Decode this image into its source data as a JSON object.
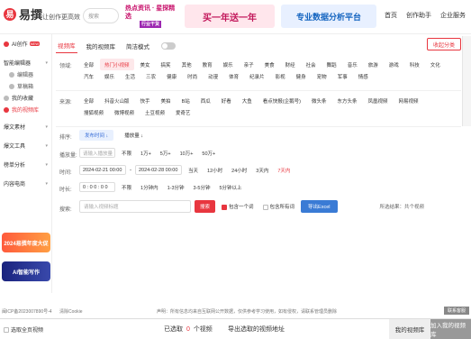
{
  "brand": {
    "logo_char": "易",
    "name": "易撰",
    "slogan": "让创作更高效"
  },
  "header_search": {
    "placeholder": "搜索"
  },
  "banners": {
    "b1_line1": "热点资讯 · 星探精选",
    "b1_line2": "行业干货",
    "b2": "买一年送一年",
    "b3": "专业数据分析平台"
  },
  "topnav": [
    "首页",
    "创作助手",
    "企业服务"
  ],
  "sidebar": {
    "items": [
      {
        "label": "AI创作",
        "badge": "NEW"
      },
      {
        "label": "智能编辑器",
        "sub": false
      },
      {
        "label": "编辑器",
        "sub": true
      },
      {
        "label": "草稿箱",
        "sub": true
      },
      {
        "label": "我的收藏",
        "sub": false
      },
      {
        "label": "我的视频库",
        "sub": false,
        "active": true
      },
      {
        "label": "爆文素材",
        "sub": false
      },
      {
        "label": "爆文工具",
        "sub": false
      },
      {
        "label": "榜单分析",
        "sub": false
      },
      {
        "label": "内容电商",
        "sub": false
      }
    ],
    "promo1": "2024易撰年度大促",
    "promo2": "AI智能写作"
  },
  "tabs": {
    "t1": "视频库",
    "t2": "我的视频库",
    "t3": "简洁模式",
    "collect": "收起分类"
  },
  "labels": {
    "domain": "领域:",
    "source": "来源:",
    "sort": "排序:",
    "plays": "播放量:",
    "time": "时间:",
    "duration": "时长:",
    "search": "搜索:"
  },
  "domain_chips": [
    "全部",
    "热门小视频",
    "美女",
    "搞笑",
    "其他",
    "教育",
    "娱乐",
    "亲子",
    "美食",
    "财经",
    "社会",
    "舞蹈",
    "音乐",
    "旅游",
    "游戏",
    "科技",
    "文化",
    "汽车",
    "娱乐",
    "生活",
    "三农",
    "健康",
    "时尚",
    "动漫",
    "体育",
    "纪录片",
    "影视",
    "健身",
    "宠物",
    "军事",
    "情感"
  ],
  "source_chips": [
    "全部",
    "抖音火山版",
    "快手",
    "美拍",
    "B站",
    "西瓜",
    "好看",
    "大鱼",
    "看点快报(企鹅号)",
    "微头条",
    "东方头条",
    "凤凰视频",
    "网易视频",
    "搜狐视频",
    "微博视频",
    "土豆视频",
    "爱奇艺"
  ],
  "sort": {
    "publish": "发布时间 ↓",
    "plays": "播放量 ↓"
  },
  "plays_row": {
    "placeholder": "请输入播放量",
    "opts": [
      "不限",
      "1万+",
      "5万+",
      "10万+",
      "50万+"
    ]
  },
  "time_row": {
    "start": "2024-02-21 00:00",
    "end": "2024-02-28 00:00",
    "opts": [
      "当天",
      "12小时",
      "24小时",
      "3天内",
      "7天内"
    ]
  },
  "duration_row": {
    "opts": [
      "不限",
      "1分钟内",
      "1-3分钟",
      "3-5分钟",
      "5分钟以上"
    ]
  },
  "search_row": {
    "placeholder": "请输入视频标题",
    "btn": "搜索",
    "include": "包含一个词",
    "include_all": "包含所有词",
    "export": "导出Excel",
    "selected": "所选结果：共个视频"
  },
  "footer": {
    "icp": "闽ICP备2023007890号-4",
    "cookie": "清除Cookie",
    "notice": "声明：所有信息均来自互联网公开数据，仅供参考学习使用，如有侵权，请联系管理员删除",
    "feedback": "联系客服"
  },
  "bottom": {
    "select_all": "选取全页视频",
    "selected_prefix": "已选取",
    "count": "0",
    "selected_suffix": "个视频",
    "export_link": "导出选取的视频地址",
    "my_lib": "我的视频库",
    "add_btn": "加入我的视频库"
  }
}
